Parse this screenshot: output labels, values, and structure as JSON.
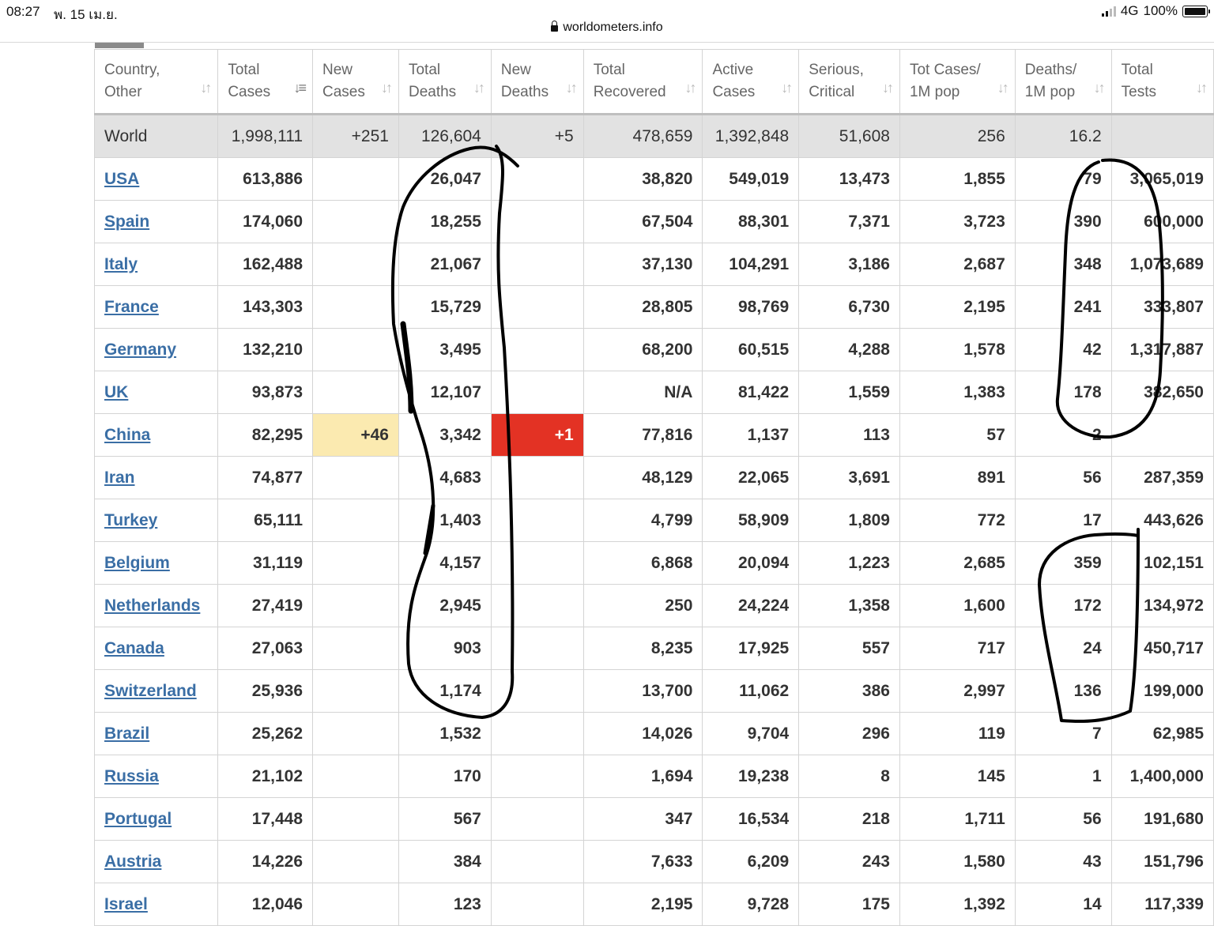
{
  "status_bar": {
    "time": "08:27",
    "date": "พ. 15 เม.ย.",
    "network": "4G",
    "battery": "100%"
  },
  "browser": {
    "url": "worldometers.info"
  },
  "table": {
    "columns": [
      [
        "Country,",
        "Other"
      ],
      [
        "Total",
        "Cases"
      ],
      [
        "New",
        "Cases"
      ],
      [
        "Total",
        "Deaths"
      ],
      [
        "New",
        "Deaths"
      ],
      [
        "Total",
        "Recovered"
      ],
      [
        "Active",
        "Cases"
      ],
      [
        "Serious,",
        "Critical"
      ],
      [
        "Tot Cases/",
        "1M pop"
      ],
      [
        "Deaths/",
        "1M pop"
      ],
      [
        "Total",
        "Tests"
      ]
    ],
    "world": [
      "World",
      "1,998,111",
      "+251",
      "126,604",
      "+5",
      "478,659",
      "1,392,848",
      "51,608",
      "256",
      "16.2",
      ""
    ],
    "rows": [
      [
        "USA",
        "613,886",
        "",
        "26,047",
        "",
        "38,820",
        "549,019",
        "13,473",
        "1,855",
        "79",
        "3,065,019"
      ],
      [
        "Spain",
        "174,060",
        "",
        "18,255",
        "",
        "67,504",
        "88,301",
        "7,371",
        "3,723",
        "390",
        "600,000"
      ],
      [
        "Italy",
        "162,488",
        "",
        "21,067",
        "",
        "37,130",
        "104,291",
        "3,186",
        "2,687",
        "348",
        "1,073,689"
      ],
      [
        "France",
        "143,303",
        "",
        "15,729",
        "",
        "28,805",
        "98,769",
        "6,730",
        "2,195",
        "241",
        "333,807"
      ],
      [
        "Germany",
        "132,210",
        "",
        "3,495",
        "",
        "68,200",
        "60,515",
        "4,288",
        "1,578",
        "42",
        "1,317,887"
      ],
      [
        "UK",
        "93,873",
        "",
        "12,107",
        "",
        "N/A",
        "81,422",
        "1,559",
        "1,383",
        "178",
        "382,650"
      ],
      [
        "China",
        "82,295",
        "+46",
        "3,342",
        "+1",
        "77,816",
        "1,137",
        "113",
        "57",
        "2",
        ""
      ],
      [
        "Iran",
        "74,877",
        "",
        "4,683",
        "",
        "48,129",
        "22,065",
        "3,691",
        "891",
        "56",
        "287,359"
      ],
      [
        "Turkey",
        "65,111",
        "",
        "1,403",
        "",
        "4,799",
        "58,909",
        "1,809",
        "772",
        "17",
        "443,626"
      ],
      [
        "Belgium",
        "31,119",
        "",
        "4,157",
        "",
        "6,868",
        "20,094",
        "1,223",
        "2,685",
        "359",
        "102,151"
      ],
      [
        "Netherlands",
        "27,419",
        "",
        "2,945",
        "",
        "250",
        "24,224",
        "1,358",
        "1,600",
        "172",
        "134,972"
      ],
      [
        "Canada",
        "27,063",
        "",
        "903",
        "",
        "8,235",
        "17,925",
        "557",
        "717",
        "24",
        "450,717"
      ],
      [
        "Switzerland",
        "25,936",
        "",
        "1,174",
        "",
        "13,700",
        "11,062",
        "386",
        "2,997",
        "136",
        "199,000"
      ],
      [
        "Brazil",
        "25,262",
        "",
        "1,532",
        "",
        "14,026",
        "9,704",
        "296",
        "119",
        "7",
        "62,985"
      ],
      [
        "Russia",
        "21,102",
        "",
        "170",
        "",
        "1,694",
        "19,238",
        "8",
        "145",
        "1",
        "1,400,000"
      ],
      [
        "Portugal",
        "17,448",
        "",
        "567",
        "",
        "347",
        "16,534",
        "218",
        "1,711",
        "56",
        "191,680"
      ],
      [
        "Austria",
        "14,226",
        "",
        "384",
        "",
        "7,633",
        "6,209",
        "243",
        "1,580",
        "43",
        "151,796"
      ],
      [
        "Israel",
        "12,046",
        "",
        "123",
        "",
        "2,195",
        "9,728",
        "175",
        "1,392",
        "14",
        "117,339"
      ]
    ],
    "highlights": {
      "china_new_cases_color": "#fbeab0",
      "china_new_deaths_color": "#e33224"
    }
  }
}
